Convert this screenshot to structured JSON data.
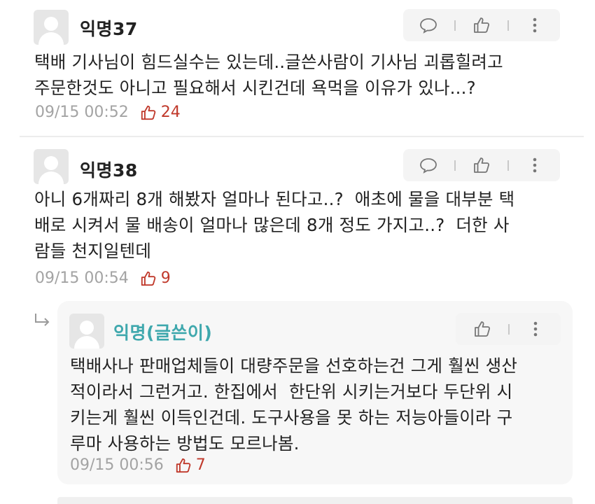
{
  "comments": [
    {
      "author": "익명37",
      "text": "택배 기사님이 힘드실수는 있는데..글쓴사람이 기사님 괴롭힐려고\n주문한것도 아니고 필요해서 시킨건데 욕먹을 이유가 있나...?",
      "timestamp": "09/15 00:52",
      "likes": "24"
    },
    {
      "author": "익명38",
      "text": "아니 6개짜리 8개 해봤자 얼마나 된다고..?  애초에 물을 대부분 택\n배로 시켜서 물 배송이 얼마나 많은데 8개 정도 가지고..?  더한 사\n람들 천지일텐데",
      "timestamp": "09/15 00:54",
      "likes": "9"
    }
  ],
  "reply": {
    "author": "익명(글쓴이)",
    "text": "택배사나 판매업체들이 대량주문을 선호하는건 그게 훨씬 생산\n적이라서 그런거고. 한집에서  한단위 시키는거보다 두단위 시\n키는게 훨씬 이득인건데. 도구사용을 못 하는 저능아들이라 구\n루마 사용하는 방법도 모르나봄.",
    "timestamp": "09/15 00:56",
    "likes": "7"
  },
  "colors": {
    "author_accent": "#3fa8ad",
    "like_accent": "#c0392b",
    "meta_gray": "#a3a3a3"
  },
  "icons": {
    "reply": "speech-bubble-icon",
    "like": "thumbs-up-icon",
    "more": "vertical-dots-icon",
    "reply_indicator": "reply-arrow-icon"
  }
}
